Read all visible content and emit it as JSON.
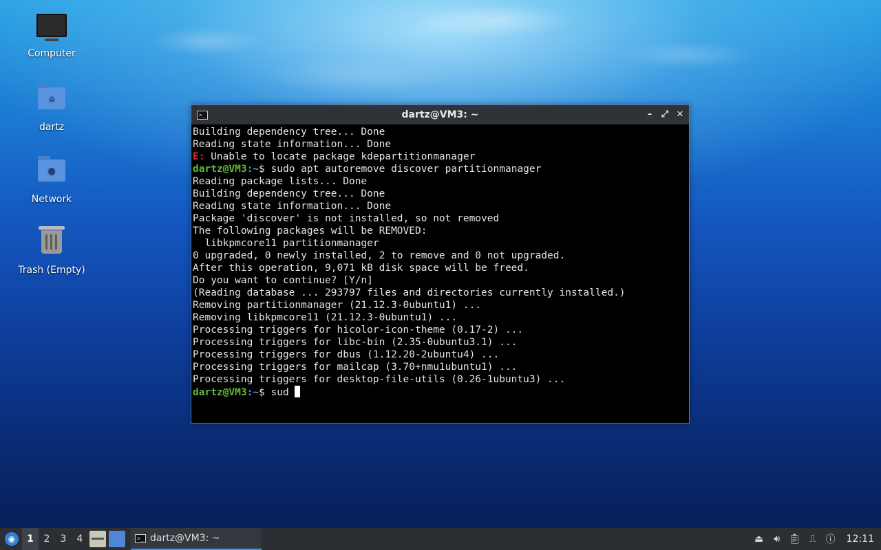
{
  "desktop": {
    "icons": [
      {
        "label": "Computer",
        "icon": "computer-icon"
      },
      {
        "label": "dartz",
        "icon": "home-folder-icon"
      },
      {
        "label": "Network",
        "icon": "network-folder-icon"
      },
      {
        "label": "Trash (Empty)",
        "icon": "trash-icon"
      }
    ]
  },
  "window": {
    "title": "dartz@VM3: ~",
    "buttons": [
      "minimize",
      "maximize",
      "close"
    ]
  },
  "terminal": {
    "lines": [
      {
        "type": "text",
        "text": "Building dependency tree... Done"
      },
      {
        "type": "text",
        "text": "Reading state information... Done"
      },
      {
        "type": "error",
        "tag": "E:",
        "text": " Unable to locate package kdepartitionmanager"
      },
      {
        "type": "prompt",
        "user": "dartz@VM3",
        "path": ":~",
        "cmd": "$ sudo apt autoremove discover partitionmanager"
      },
      {
        "type": "text",
        "text": "Reading package lists... Done"
      },
      {
        "type": "text",
        "text": "Building dependency tree... Done"
      },
      {
        "type": "text",
        "text": "Reading state information... Done"
      },
      {
        "type": "text",
        "text": "Package 'discover' is not installed, so not removed"
      },
      {
        "type": "text",
        "text": "The following packages will be REMOVED:"
      },
      {
        "type": "text",
        "text": "  libkpmcore11 partitionmanager"
      },
      {
        "type": "text",
        "text": "0 upgraded, 0 newly installed, 2 to remove and 0 not upgraded."
      },
      {
        "type": "text",
        "text": "After this operation, 9,071 kB disk space will be freed."
      },
      {
        "type": "text",
        "text": "Do you want to continue? [Y/n]"
      },
      {
        "type": "text",
        "text": "(Reading database ... 293797 files and directories currently installed.)"
      },
      {
        "type": "text",
        "text": "Removing partitionmanager (21.12.3-0ubuntu1) ..."
      },
      {
        "type": "text",
        "text": "Removing libkpmcore11 (21.12.3-0ubuntu1) ..."
      },
      {
        "type": "text",
        "text": "Processing triggers for hicolor-icon-theme (0.17-2) ..."
      },
      {
        "type": "text",
        "text": "Processing triggers for libc-bin (2.35-0ubuntu3.1) ..."
      },
      {
        "type": "text",
        "text": "Processing triggers for dbus (1.12.20-2ubuntu4) ..."
      },
      {
        "type": "text",
        "text": "Processing triggers for mailcap (3.70+nmu1ubuntu1) ..."
      },
      {
        "type": "text",
        "text": "Processing triggers for desktop-file-utils (0.26-1ubuntu3) ..."
      },
      {
        "type": "prompt",
        "user": "dartz@VM3",
        "path": ":~",
        "cmd": "$ sud ",
        "cursor": true
      }
    ]
  },
  "taskbar": {
    "workspaces": [
      "1",
      "2",
      "3",
      "4"
    ],
    "active_workspace": "1",
    "task_label": "dartz@VM3: ~",
    "clock": "12:11"
  }
}
